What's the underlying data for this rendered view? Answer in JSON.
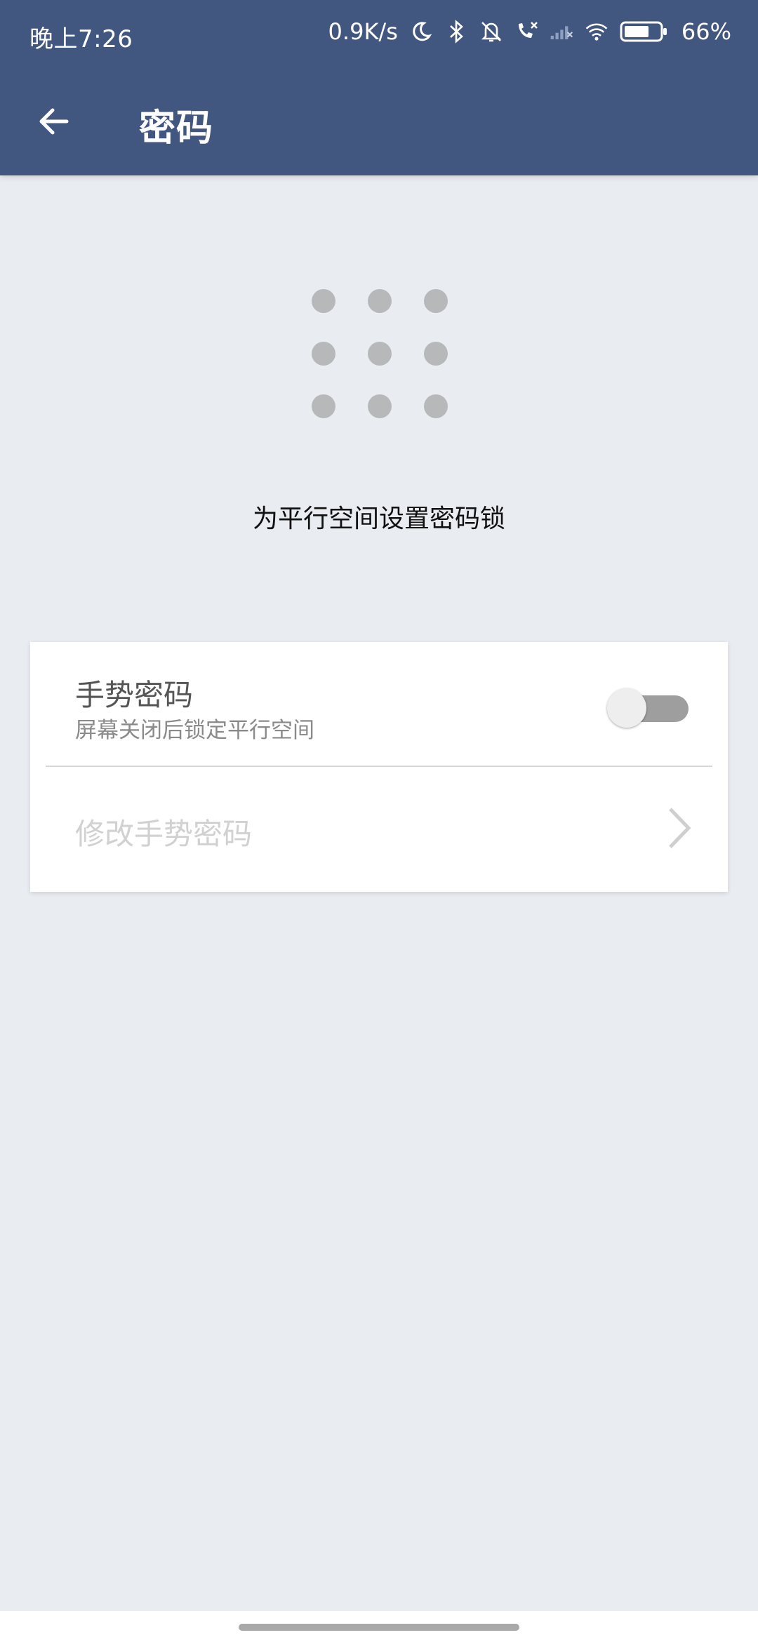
{
  "status": {
    "time": "晚上7:26",
    "net_speed": "0.9K/s",
    "battery": "66%"
  },
  "appbar": {
    "title": "密码"
  },
  "hint": "为平行空间设置密码锁",
  "settings": {
    "gesture_title": "手势密码",
    "gesture_subtitle": "屏幕关闭后锁定平行空间",
    "gesture_enabled": false,
    "change_title": "修改手势密码"
  },
  "colors": {
    "header": "#42577f",
    "background": "#e9ecf1",
    "card": "#ffffff"
  }
}
